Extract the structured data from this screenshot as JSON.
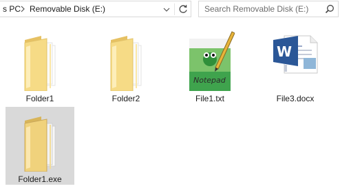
{
  "address_bar": {
    "crumbs": [
      "s PC",
      "Removable Disk (E:)"
    ]
  },
  "search": {
    "placeholder": "Search Removable Disk (E:)"
  },
  "items": [
    {
      "name": "Folder1",
      "icon": "folder-icon"
    },
    {
      "name": "Folder2",
      "icon": "folder-icon"
    },
    {
      "name": "File1.txt",
      "icon": "notepad-plus-plus-icon"
    },
    {
      "name": "File3.docx",
      "icon": "word-document-icon"
    },
    {
      "name": "Folder1.exe",
      "icon": "folder-icon",
      "selected": true
    }
  ],
  "colors": {
    "folder": "#f3d57a",
    "folder_light": "#fbe7a6",
    "selection": "#d9d9d9",
    "word_blue": "#2b5797"
  }
}
